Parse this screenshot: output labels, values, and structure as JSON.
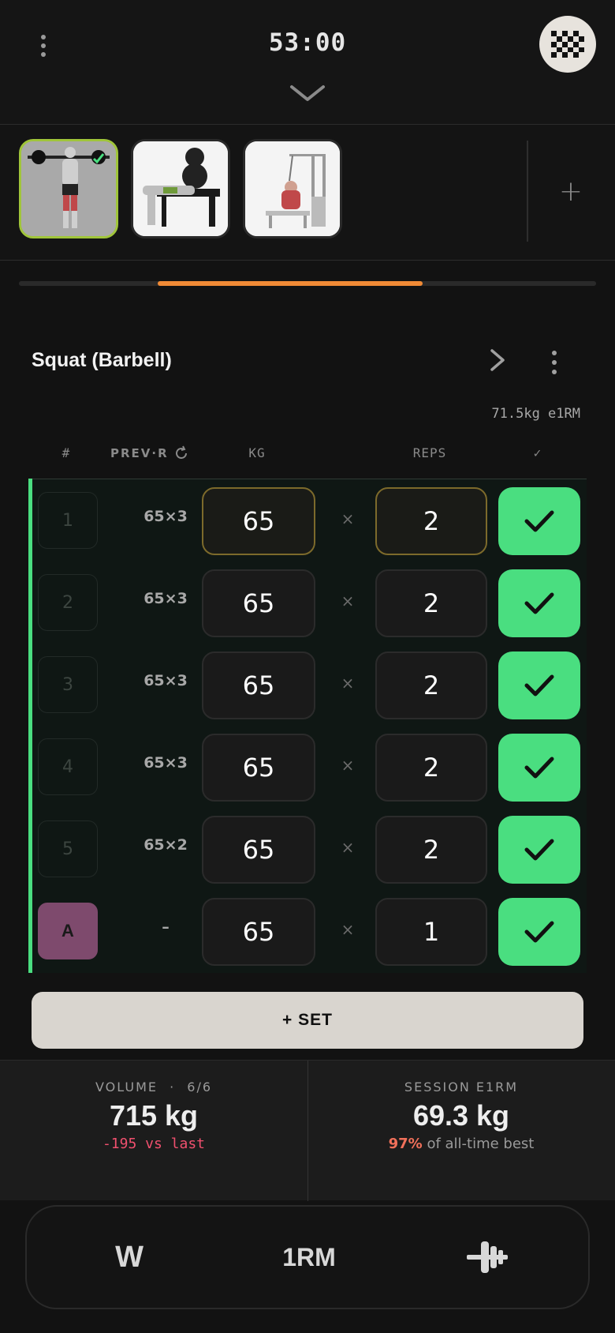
{
  "header": {
    "timer": "53:00"
  },
  "thumbs": {
    "add_label": "+"
  },
  "progress": {
    "start": 0.24,
    "end": 0.7
  },
  "exercise": {
    "title": "Squat (Barbell)",
    "e1rm": "71.5kg e1RM"
  },
  "columns": {
    "set": "#",
    "prev": "PREV·R",
    "kg": "KG",
    "reps": "REPS",
    "done": "✓"
  },
  "sets": [
    {
      "no": "1",
      "prev": "65×3",
      "kg": "65",
      "x": "×",
      "reps": "2",
      "active": true
    },
    {
      "no": "2",
      "prev": "65×3",
      "kg": "65",
      "x": "×",
      "reps": "2"
    },
    {
      "no": "3",
      "prev": "65×3",
      "kg": "65",
      "x": "×",
      "reps": "2"
    },
    {
      "no": "4",
      "prev": "65×3",
      "kg": "65",
      "x": "×",
      "reps": "2"
    },
    {
      "no": "5",
      "prev": "65×2",
      "kg": "65",
      "x": "×",
      "reps": "2"
    },
    {
      "no": "A",
      "prev": "–",
      "kg": "65",
      "x": "×",
      "reps": "1",
      "warmup": true
    }
  ],
  "add_set": "+ SET",
  "stats": {
    "volume_label": "VOLUME",
    "volume_sep": "·",
    "volume_count": "6/6",
    "volume_value": "715 kg",
    "volume_delta": "-195 vs last",
    "e1rm_label": "SESSION E1RM",
    "e1rm_value": "69.3 kg",
    "e1rm_pct": "97%",
    "e1rm_sub": "of all-time best"
  },
  "toolbar": {
    "warmup": "W",
    "onerm": "1RM"
  },
  "colors": {
    "accent_green": "#4ade80",
    "accent_orange": "#f08a35",
    "negative": "#f0506e",
    "warmup": "#7e4a6d"
  }
}
